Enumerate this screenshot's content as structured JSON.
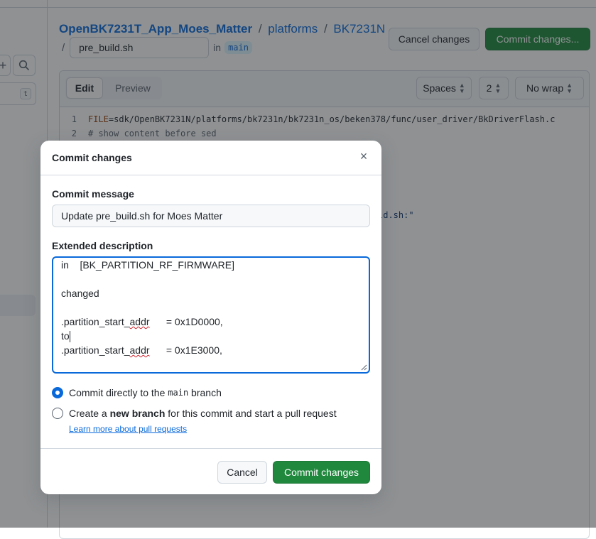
{
  "breadcrumb": {
    "repo": "OpenBK7231T_App_Moes_Matter",
    "sep1": "/",
    "folder1": "platforms",
    "sep2": "/",
    "folder2": "BK7231N"
  },
  "filename": {
    "slash": "/",
    "value": "pre_build.sh",
    "in_text": "in",
    "branch": "main"
  },
  "top_actions": {
    "cancel": "Cancel changes",
    "commit": "Commit changes..."
  },
  "sidebar": {
    "plus": "+",
    "kbd": "t"
  },
  "editor": {
    "tab_edit": "Edit",
    "tab_preview": "Preview",
    "indent_mode": "Spaces",
    "indent_size": "2",
    "wrap_mode": "No wrap",
    "lines": [
      {
        "num": "1",
        "kw": "FILE",
        "rest": "=sdk/OpenBK7231N/platforms/bk7231n/bk7231n_os/beken378/func/user_driver/BkDriverFlash.c"
      },
      {
        "num": "2",
        "kw": "",
        "rest": "# show content before sed"
      }
    ],
    "partial_fragment": "ld.sh:\""
  },
  "dialog": {
    "title": "Commit changes",
    "close_glyph": "×",
    "message_label": "Commit message",
    "message_value": "Update pre_build.sh for Moes Matter",
    "description_label": "Extended description",
    "description_lines": {
      "l1": "in    [BK_PARTITION_RF_FIRMWARE]",
      "l2": "changed",
      "l3_a": ".partition_start_",
      "l3_b": "addr",
      "l3_c": "      = 0x1D0000,",
      "l4": "to",
      "l5_a": ".partition_start_",
      "l5_b": "addr",
      "l5_c": "      = 0x1E3000,"
    },
    "option_direct": {
      "pre": "Commit directly to the ",
      "branch": "main",
      "post": " branch"
    },
    "option_new": {
      "pre": "Create a ",
      "bold": "new branch",
      "post": " for this commit and start a pull request"
    },
    "learn_more": "Learn more about pull requests",
    "cancel": "Cancel",
    "commit": "Commit changes"
  },
  "colors": {
    "primary_green": "#1f883d",
    "link_blue": "#0969da",
    "overlay": "rgba(31,35,40,0.5)"
  }
}
